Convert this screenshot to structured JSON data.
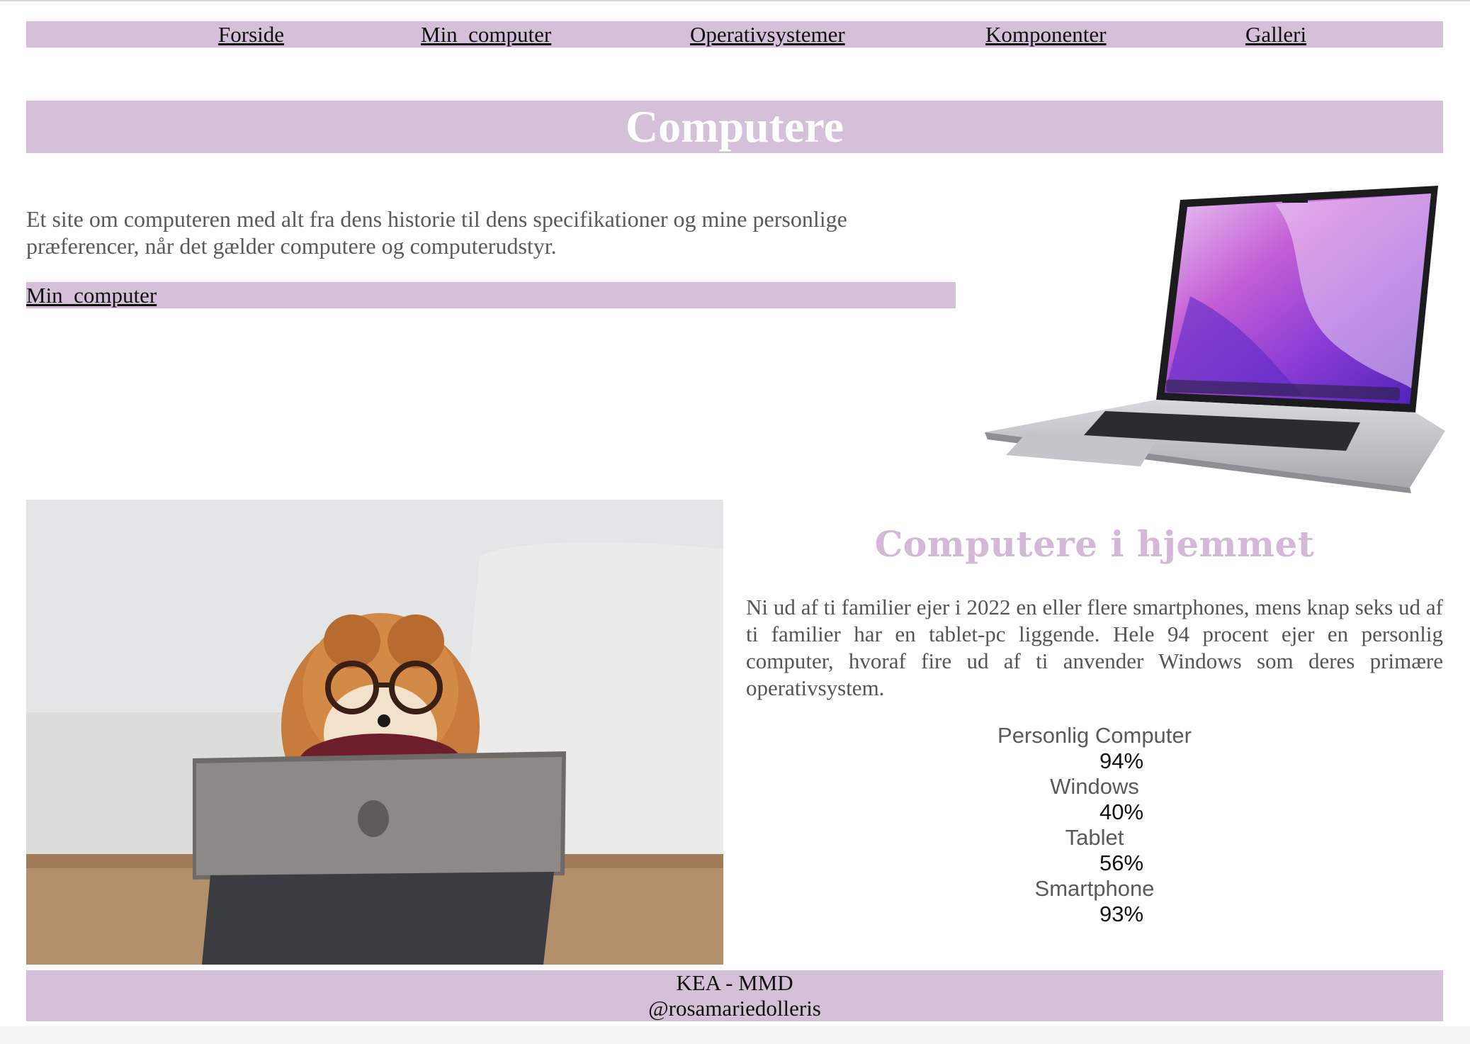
{
  "nav": {
    "items": [
      {
        "label": "Forside"
      },
      {
        "label": "Min_computer"
      },
      {
        "label": "Operativsystemer"
      },
      {
        "label": "Komponenter"
      },
      {
        "label": "Galleri"
      }
    ]
  },
  "header": {
    "title": "Computere"
  },
  "intro": {
    "text": "Et site om computeren med alt fra dens historie til dens specifikationer og mine personlige præferencer, når det gælder computere og computerudstyr.",
    "link_label": "Min_computer"
  },
  "home": {
    "title": "Computere i hjemmet",
    "text": "Ni ud af ti familier ejer i 2022 en eller flere smartphones, mens knap seks ud af ti familier har en tablet-pc liggende. Hele 94 procent ejer en personlig computer, hvoraf fire ud af ti anvender Windows som deres primære operativsystem.",
    "stats": [
      {
        "label": "Personlig Computer",
        "value": "94%"
      },
      {
        "label": "Windows",
        "value": "40%"
      },
      {
        "label": "Tablet",
        "value": "56%"
      },
      {
        "label": "Smartphone",
        "value": "93%"
      }
    ]
  },
  "footer": {
    "line1": "KEA - MMD",
    "line2": "@rosamariedolleris"
  },
  "colors": {
    "accent": "#d4c0d8",
    "title_accent": "#d4b8d8"
  }
}
